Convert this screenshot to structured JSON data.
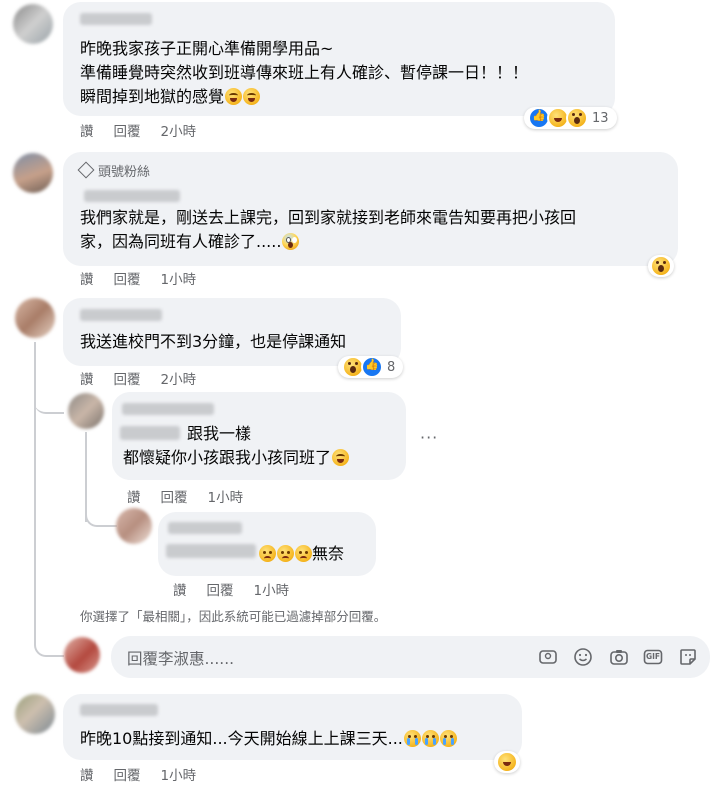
{
  "comments": [
    {
      "lines": [
        "昨晚我家孩子正開心準備開學用品~",
        "準備睡覺時突然收到班導傳來班上有人確診、暫停課一日！！！",
        "瞬間掉到地獄的感覺"
      ],
      "actions": {
        "like": "讚",
        "reply": "回覆",
        "time": "2小時"
      },
      "reaction_count": "13"
    },
    {
      "badge": "頭號粉絲",
      "lines": [
        "我們家就是，剛送去上課完，回到家就接到老師來電告知要再把小孩回",
        "家，因為同班有人確診了....."
      ],
      "actions": {
        "like": "讚",
        "reply": "回覆",
        "time": "1小時"
      }
    },
    {
      "lines": [
        "我送進校門不到3分鐘，也是停課通知"
      ],
      "actions": {
        "like": "讚",
        "reply": "回覆",
        "time": "2小時"
      },
      "reaction_count": "8"
    },
    {
      "lines": [
        "跟我一樣",
        "都懷疑你小孩跟我小孩同班了"
      ],
      "actions": {
        "like": "讚",
        "reply": "回覆",
        "time": "1小時"
      },
      "more": "···"
    },
    {
      "lines": [
        "無奈"
      ],
      "actions": {
        "like": "讚",
        "reply": "回覆",
        "time": "1小時"
      }
    },
    {
      "lines": [
        "昨晚10點接到通知...今天開始線上上課三天..."
      ],
      "actions": {
        "like": "讚",
        "reply": "回覆",
        "time": "1小時"
      }
    }
  ],
  "filter_notice": "你選擇了「最相關」，因此系統可能已過濾掉部分回覆。",
  "reply_input": {
    "placeholder": "回覆李淑惠......"
  },
  "toolbar": {
    "gif_label": "GIF"
  },
  "colors": {
    "bubble": "#f0f2f5",
    "meta": "#65676b",
    "like_blue": "#1877f2"
  }
}
